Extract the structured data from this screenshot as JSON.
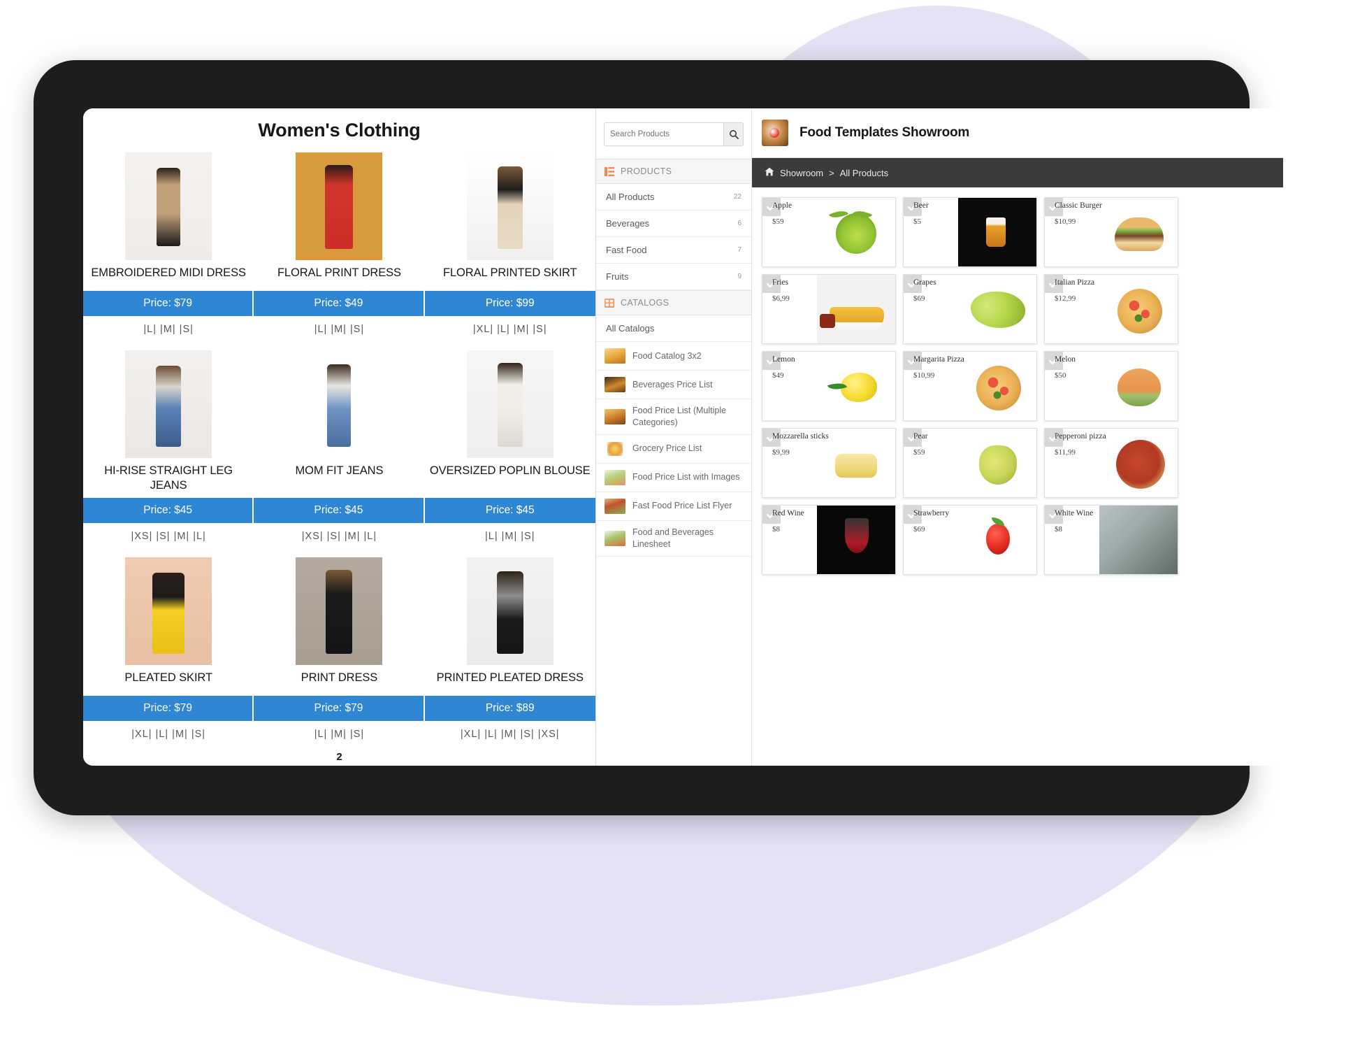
{
  "catalog": {
    "title": "Women's Clothing",
    "page_number": "2",
    "rows": [
      {
        "products": [
          {
            "name": "EMBROIDERED MIDI DRESS",
            "price": "Price: $79",
            "sizes": "|L| |M| |S|"
          },
          {
            "name": "FLORAL PRINT DRESS",
            "price": "Price: $49",
            "sizes": "|L| |M| |S|"
          },
          {
            "name": "FLORAL PRINTED SKIRT",
            "price": "Price: $99",
            "sizes": "|XL| |L| |M| |S|"
          }
        ]
      },
      {
        "products": [
          {
            "name": "HI-RISE STRAIGHT LEG JEANS",
            "price": "Price: $45",
            "sizes": "|XS| |S| |M| |L|"
          },
          {
            "name": "MOM FIT JEANS",
            "price": "Price: $45",
            "sizes": "|XS| |S| |M| |L|"
          },
          {
            "name": "OVERSIZED POPLIN BLOUSE",
            "price": "Price: $45",
            "sizes": "|L| |M| |S|"
          }
        ]
      },
      {
        "products": [
          {
            "name": "PLEATED SKIRT",
            "price": "Price: $79",
            "sizes": "|XL| |L| |M| |S|"
          },
          {
            "name": "PRINT DRESS",
            "price": "Price: $79",
            "sizes": "|L| |M| |S|"
          },
          {
            "name": "PRINTED PLEATED DRESS",
            "price": "Price: $89",
            "sizes": "|XL| |L| |M| |S| |XS|"
          }
        ]
      }
    ]
  },
  "sidebar": {
    "search": {
      "placeholder": "Search Products",
      "value": "",
      "icon": "search-icon"
    },
    "products_section": {
      "label": "PRODUCTS",
      "icon": "list-icon"
    },
    "product_items": [
      {
        "label": "All Products",
        "count": "22"
      },
      {
        "label": "Beverages",
        "count": "6"
      },
      {
        "label": "Fast Food",
        "count": "7"
      },
      {
        "label": "Fruits",
        "count": "9"
      }
    ],
    "catalogs_section": {
      "label": "CATALOGS",
      "icon": "grid-icon"
    },
    "all_catalogs_label": "All Catalogs",
    "catalog_items": [
      {
        "label": "Food Catalog 3x2",
        "thumb": "th1"
      },
      {
        "label": "Beverages Price List",
        "thumb": "th2"
      },
      {
        "label": "Food Price List (Multiple Categories)",
        "thumb": "th3"
      },
      {
        "label": "Grocery Price List",
        "thumb": "th4"
      },
      {
        "label": "Food Price List with Images",
        "thumb": "th5"
      },
      {
        "label": "Fast Food Price List Flyer",
        "thumb": "th6"
      },
      {
        "label": "Food and Beverages Linesheet",
        "thumb": "th7"
      }
    ]
  },
  "showroom": {
    "logo_icon": "food-bowl-logo",
    "title": "Food Templates Showroom",
    "breadcrumb": {
      "home_icon": "home-icon",
      "items": [
        "Showroom",
        "All Products"
      ],
      "separator": ">"
    },
    "products": [
      {
        "name": "Apple",
        "price": "$59",
        "img": "apple"
      },
      {
        "name": "Beer",
        "price": "$5",
        "img": "beer"
      },
      {
        "name": "Classic Burger",
        "price": "$10,99",
        "img": "burger"
      },
      {
        "name": "Fries",
        "price": "$6,99",
        "img": "fries"
      },
      {
        "name": "Grapes",
        "price": "$69",
        "img": "grapes"
      },
      {
        "name": "Italian Pizza",
        "price": "$12,99",
        "img": "italian-pizza"
      },
      {
        "name": "Lemon",
        "price": "$49",
        "img": "lemon"
      },
      {
        "name": "Margarita Pizza",
        "price": "$10,99",
        "img": "margarita-pizza"
      },
      {
        "name": "Melon",
        "price": "$50",
        "img": "melon"
      },
      {
        "name": "Mozzarella sticks",
        "price": "$9,99",
        "img": "mozzarella"
      },
      {
        "name": "Pear",
        "price": "$59",
        "img": "pear"
      },
      {
        "name": "Pepperoni pizza",
        "price": "$11,99",
        "img": "pepperoni-pizza"
      },
      {
        "name": "Red Wine",
        "price": "$8",
        "img": "red-wine"
      },
      {
        "name": "Strawberry",
        "price": "$69",
        "img": "strawberry"
      },
      {
        "name": "White Wine",
        "price": "$8",
        "img": "white-wine"
      }
    ]
  },
  "colors": {
    "price_bar": "#2f86d2",
    "breadcrumb_bar": "#3b3b3b",
    "section_accent": "#f0894a",
    "device_frame": "#1d1d1d",
    "backdrop_blob": "#e6e2f5"
  }
}
